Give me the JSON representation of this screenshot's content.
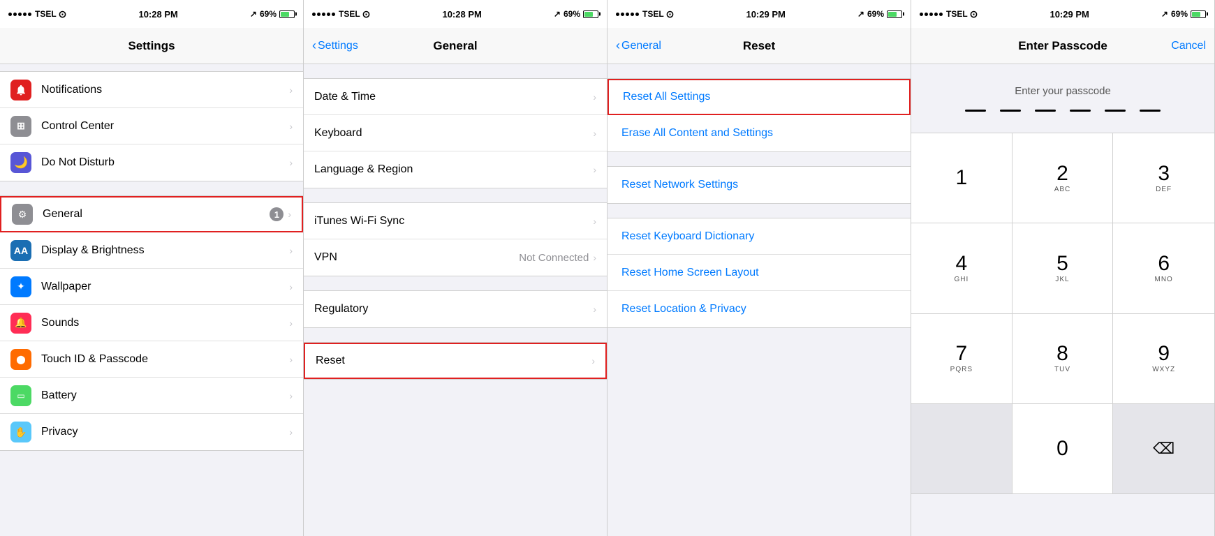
{
  "panels": [
    {
      "id": "settings",
      "statusBar": {
        "carrier": "TSEL",
        "time": "10:28 PM",
        "signal": "69%"
      },
      "navTitle": "Settings",
      "navBack": null,
      "sections": [
        {
          "items": [
            {
              "icon": "notifications",
              "iconBg": "icon-red",
              "label": "Notifications",
              "value": "",
              "badge": "",
              "highlighted": false
            },
            {
              "icon": "control-center",
              "iconBg": "icon-gray",
              "label": "Control Center",
              "value": "",
              "badge": "",
              "highlighted": false
            },
            {
              "icon": "do-not-disturb",
              "iconBg": "icon-purple",
              "label": "Do Not Disturb",
              "value": "",
              "badge": "",
              "highlighted": false
            }
          ]
        },
        {
          "items": [
            {
              "icon": "general",
              "iconBg": "icon-gray",
              "label": "General",
              "value": "",
              "badge": "1",
              "highlighted": true
            },
            {
              "icon": "display",
              "iconBg": "icon-blue-dark",
              "label": "Display & Brightness",
              "value": "",
              "badge": "",
              "highlighted": false
            },
            {
              "icon": "wallpaper",
              "iconBg": "icon-blue",
              "label": "Wallpaper",
              "value": "",
              "badge": "",
              "highlighted": false
            },
            {
              "icon": "sounds",
              "iconBg": "icon-pink",
              "label": "Sounds",
              "value": "",
              "badge": "",
              "highlighted": false
            },
            {
              "icon": "touch-id",
              "iconBg": "icon-orange",
              "label": "Touch ID & Passcode",
              "value": "",
              "badge": "",
              "highlighted": false
            },
            {
              "icon": "battery",
              "iconBg": "icon-green",
              "label": "Battery",
              "value": "",
              "badge": "",
              "highlighted": false
            },
            {
              "icon": "privacy",
              "iconBg": "icon-teal",
              "label": "Privacy",
              "value": "",
              "badge": "",
              "highlighted": false
            }
          ]
        }
      ]
    },
    {
      "id": "general",
      "statusBar": {
        "carrier": "TSEL",
        "time": "10:28 PM",
        "signal": "69%"
      },
      "navTitle": "General",
      "navBack": "Settings",
      "sections": [
        {
          "items": [
            {
              "label": "Date & Time",
              "value": "",
              "highlighted": false
            },
            {
              "label": "Keyboard",
              "value": "",
              "highlighted": false
            },
            {
              "label": "Language & Region",
              "value": "",
              "highlighted": false
            }
          ]
        },
        {
          "items": [
            {
              "label": "iTunes Wi-Fi Sync",
              "value": "",
              "highlighted": false
            },
            {
              "label": "VPN",
              "value": "Not Connected",
              "highlighted": false
            }
          ]
        },
        {
          "items": [
            {
              "label": "Regulatory",
              "value": "",
              "highlighted": false
            }
          ]
        },
        {
          "items": [
            {
              "label": "Reset",
              "value": "",
              "highlighted": true
            }
          ]
        }
      ]
    },
    {
      "id": "reset",
      "statusBar": {
        "carrier": "TSEL",
        "time": "10:29 PM",
        "signal": "69%"
      },
      "navTitle": "Reset",
      "navBack": "General",
      "resetItems": [
        {
          "label": "Reset All Settings",
          "highlighted": true
        },
        {
          "label": "Erase All Content and Settings",
          "highlighted": false
        }
      ],
      "resetItems2": [
        {
          "label": "Reset Network Settings",
          "highlighted": false
        }
      ],
      "resetItems3": [
        {
          "label": "Reset Keyboard Dictionary",
          "highlighted": false
        },
        {
          "label": "Reset Home Screen Layout",
          "highlighted": false
        },
        {
          "label": "Reset Location & Privacy",
          "highlighted": false
        }
      ]
    },
    {
      "id": "passcode",
      "statusBar": {
        "carrier": "TSEL",
        "time": "10:29 PM",
        "signal": "69%"
      },
      "navTitle": "Enter Passcode",
      "navCancel": "Cancel",
      "prompt": "Enter your passcode",
      "numpad": [
        {
          "digit": "1",
          "letters": ""
        },
        {
          "digit": "2",
          "letters": "ABC"
        },
        {
          "digit": "3",
          "letters": "DEF"
        },
        {
          "digit": "4",
          "letters": "GHI"
        },
        {
          "digit": "5",
          "letters": "JKL"
        },
        {
          "digit": "6",
          "letters": "MNO"
        },
        {
          "digit": "7",
          "letters": "PQRS"
        },
        {
          "digit": "8",
          "letters": "TUV"
        },
        {
          "digit": "9",
          "letters": "WXYZ"
        },
        {
          "digit": "",
          "letters": ""
        },
        {
          "digit": "0",
          "letters": ""
        },
        {
          "digit": "⌫",
          "letters": ""
        }
      ]
    }
  ]
}
